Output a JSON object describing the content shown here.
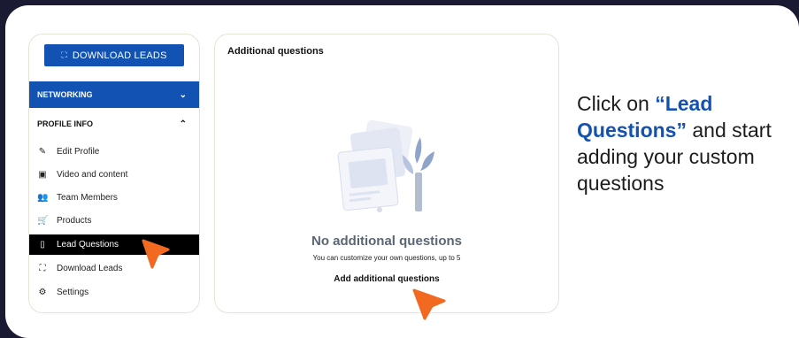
{
  "sidebar": {
    "download_button": "DOWNLOAD LEADS",
    "sections": [
      {
        "label": "NETWORKING",
        "expanded": false
      },
      {
        "label": "PROFILE INFO",
        "expanded": true
      }
    ],
    "items": [
      {
        "label": "Edit Profile",
        "icon": "pencil-icon"
      },
      {
        "label": "Video and content",
        "icon": "video-library-icon"
      },
      {
        "label": "Team Members",
        "icon": "people-icon"
      },
      {
        "label": "Products",
        "icon": "cart-icon"
      },
      {
        "label": "Lead Questions",
        "icon": "phone-icon",
        "active": true
      },
      {
        "label": "Download Leads",
        "icon": "expand-icon"
      },
      {
        "label": "Settings",
        "icon": "gear-icon"
      }
    ]
  },
  "panel": {
    "title": "Additional questions",
    "empty_title": "No additional questions",
    "empty_subtitle": "You can customize your own questions, up to 5",
    "add_link": "Add additional questions"
  },
  "callout": {
    "prefix": "Click on ",
    "highlight": "“Lead Questions”",
    "suffix": " and start adding your custom questions"
  },
  "colors": {
    "accent": "#1252b3",
    "pointer": "#f26a21",
    "background": "#1b1a33"
  }
}
